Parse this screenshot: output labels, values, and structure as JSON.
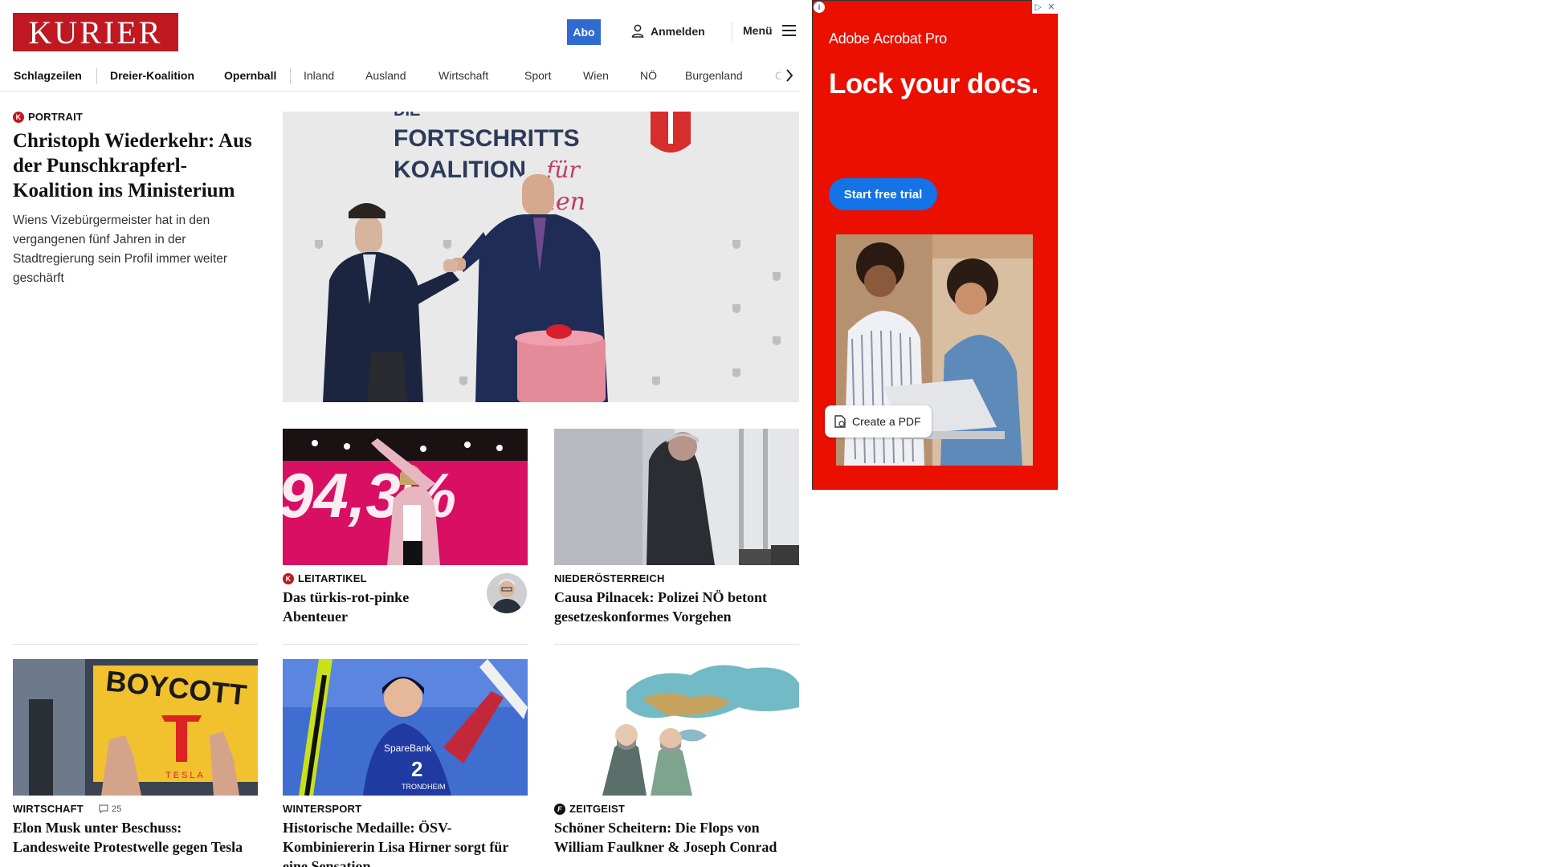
{
  "header": {
    "logo": "KURIER",
    "abo_label": "Abo",
    "login_label": "Anmelden",
    "menu_label": "Menü"
  },
  "nav": {
    "items": [
      "Schlagzeilen",
      "Dreier-Koalition",
      "Opernball",
      "Inland",
      "Ausland",
      "Wirtschaft",
      "Sport",
      "Wien",
      "NÖ",
      "Burgenland",
      "Oö"
    ]
  },
  "lead": {
    "kicker": "PORTRAIT",
    "badge": "K",
    "title": "Christoph Wiederkehr: Aus der Punschkrapferl-Koalition ins Ministerium",
    "teaser": "Wiens Vizebürgermeister hat in den vergangenen fünf Jahren in der Stadtregierung sein Profil immer weiter geschärft",
    "image_text_1": "DIE",
    "image_text_2": "FORTSCHRITTS",
    "image_text_3": "KOALITION",
    "image_text_4": "für",
    "image_text_5": "Wien"
  },
  "row1": [
    {
      "kicker": "LEITARTIKEL",
      "badge": "K",
      "title": "Das türkis-rot-pinke Abenteuer",
      "image_text": "94,3%"
    },
    {
      "kicker": "NIEDERÖSTERREICH",
      "title": "Causa Pilnacek: Polizei NÖ betont gesetzeskonformes Vorgehen"
    }
  ],
  "row2": [
    {
      "kicker": "WIRTSCHAFT",
      "comments": "25",
      "title": "Elon Musk unter Beschuss: Landesweite Protestwelle gegen Tesla",
      "image_text_1": "BOYCOTT",
      "image_text_2": "TESLA"
    },
    {
      "kicker": "WINTERSPORT",
      "title": "Historische Medaille: ÖSV-Kombiniererin Lisa Hirner sorgt für eine Sensation",
      "image_text_1": "SpareBank",
      "image_text_2": "2",
      "image_text_3": "TRONDHEIM"
    },
    {
      "kicker": "ZEITGEIST",
      "badge": "f",
      "title": "Schöner Scheitern: Die Flops von William Faulkner & Joseph Conrad"
    }
  ],
  "ad": {
    "brand": "Adobe",
    "product": "Acrobat Pro",
    "headline": "Lock your docs.",
    "cta": "Start free trial",
    "pill": "Create a PDF",
    "colors": {
      "background": "#eb0f00",
      "cta": "#1473e6"
    }
  },
  "colors": {
    "brand_red": "#c01820",
    "abo_blue": "#2f6ad0"
  }
}
